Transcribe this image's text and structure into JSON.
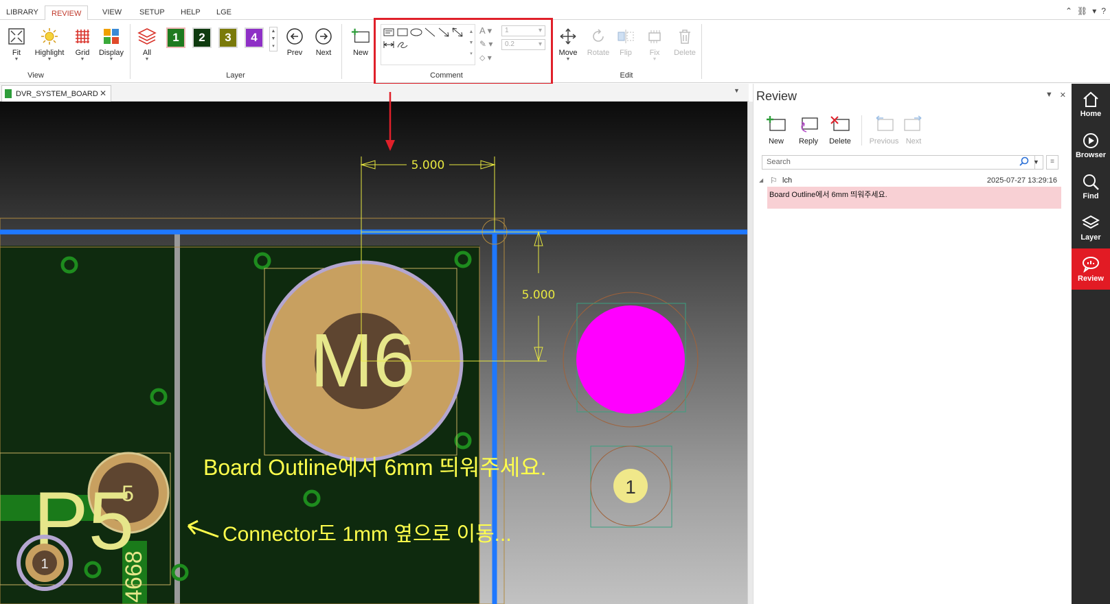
{
  "menu": {
    "tabs": [
      "LIBRARY",
      "REVIEW",
      "VIEW",
      "SETUP",
      "HELP",
      "LGE"
    ],
    "active": "REVIEW"
  },
  "ribbon": {
    "view": {
      "fit": "Fit",
      "highlight": "Highlight",
      "grid": "Grid",
      "display": "Display",
      "group": "View"
    },
    "layer": {
      "all": "All",
      "layers": [
        "1",
        "2",
        "3",
        "4"
      ],
      "layer_colors": [
        "#1f7a1f",
        "#0f3b0f",
        "#7a7a0a",
        "#8e30c6"
      ],
      "prev": "Prev",
      "next": "Next",
      "group": "Layer"
    },
    "new": "New",
    "comment": {
      "group": "Comment",
      "width_value": "1",
      "size_value": "0.2"
    },
    "edit": {
      "move": "Move",
      "rotate": "Rotate",
      "flip": "Flip",
      "fix": "Fix",
      "delete": "Delete",
      "group": "Edit"
    }
  },
  "document_tab": {
    "title": "DVR_SYSTEM_BOARD"
  },
  "canvas": {
    "dim_horizontal": "5.000",
    "dim_vertical": "5.000",
    "part_label": "M6",
    "connector_label": "P5",
    "connector_pin": "1",
    "connector_pad_digit": "5",
    "pad_number": "1",
    "vertical_text": "4668",
    "comment_1": "Board Outline에서 6mm 띄워주세요.",
    "comment_2": "Connector도 1mm 옆으로 이동...",
    "colors": {
      "outline": "#1e78ff",
      "text": "#ffff4c",
      "magenta": "#ff00ff",
      "pad": "#c8a060",
      "board": "#0e2a0e"
    }
  },
  "review_panel": {
    "title": "Review",
    "buttons": {
      "new": "New",
      "reply": "Reply",
      "delete": "Delete",
      "previous": "Previous",
      "next": "Next"
    },
    "search_placeholder": "Search",
    "entries": [
      {
        "author": "lch",
        "date": "2025-07-27 13:29:16",
        "text": "Board Outline에서 6mm 띄워주세요."
      }
    ]
  },
  "right_nav": {
    "items": [
      {
        "label": "Home",
        "icon": "home-icon"
      },
      {
        "label": "Browser",
        "icon": "browser-icon"
      },
      {
        "label": "Find",
        "icon": "search-icon"
      },
      {
        "label": "Layer",
        "icon": "layers-icon"
      },
      {
        "label": "Review",
        "icon": "review-icon"
      }
    ],
    "active": "Review"
  }
}
